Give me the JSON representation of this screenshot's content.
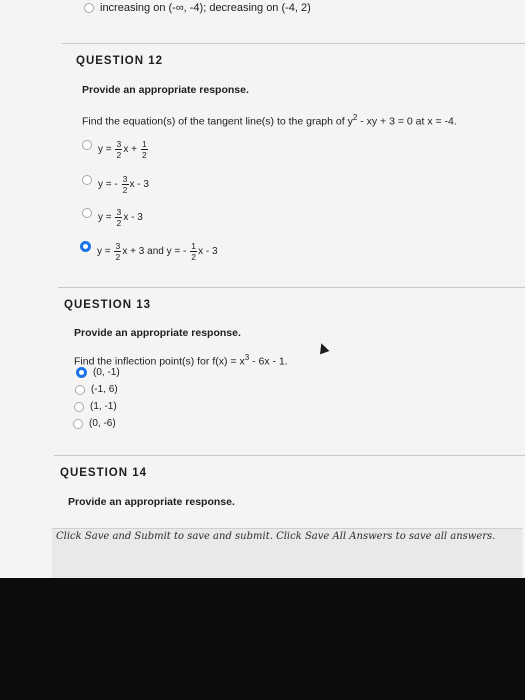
{
  "previous_answer": "increasing on (-∞, -4); decreasing on (-4, 2)",
  "q12": {
    "title": "QUESTION 12",
    "prompt": "Provide an appropriate response.",
    "text_before": "Find the equation(s) of the tangent line(s) to the graph of y",
    "exponent": "2",
    "text_after": " - xy + 3 = 0 at x = -4.",
    "options": [
      {
        "selected": false,
        "parts": [
          "y = ",
          {
            "n": "3",
            "d": "2"
          },
          "x + ",
          {
            "n": "1",
            "d": "2"
          }
        ]
      },
      {
        "selected": false,
        "parts": [
          "y = - ",
          {
            "n": "3",
            "d": "2"
          },
          "x - 3"
        ]
      },
      {
        "selected": false,
        "parts": [
          "y = ",
          {
            "n": "3",
            "d": "2"
          },
          "x - 3"
        ]
      },
      {
        "selected": true,
        "parts": [
          "y = ",
          {
            "n": "3",
            "d": "2"
          },
          "x + 3 and y = - ",
          {
            "n": "1",
            "d": "2"
          },
          "x - 3"
        ]
      }
    ]
  },
  "q13": {
    "title": "QUESTION 13",
    "prompt": "Provide an appropriate response.",
    "text_before": "Find the inflection point(s) for f(x) = x",
    "exponent": "3",
    "text_after": " - 6x - 1.",
    "options": [
      {
        "label": "(0, -1)",
        "selected": true
      },
      {
        "label": "(-1, 6)",
        "selected": false
      },
      {
        "label": "(1, -1)",
        "selected": false
      },
      {
        "label": "(0, -6)",
        "selected": false
      }
    ]
  },
  "q14": {
    "title": "QUESTION 14",
    "prompt": "Provide an appropriate response."
  },
  "footer": "Click Save and Submit to save and submit. Click Save All Answers to save all answers."
}
